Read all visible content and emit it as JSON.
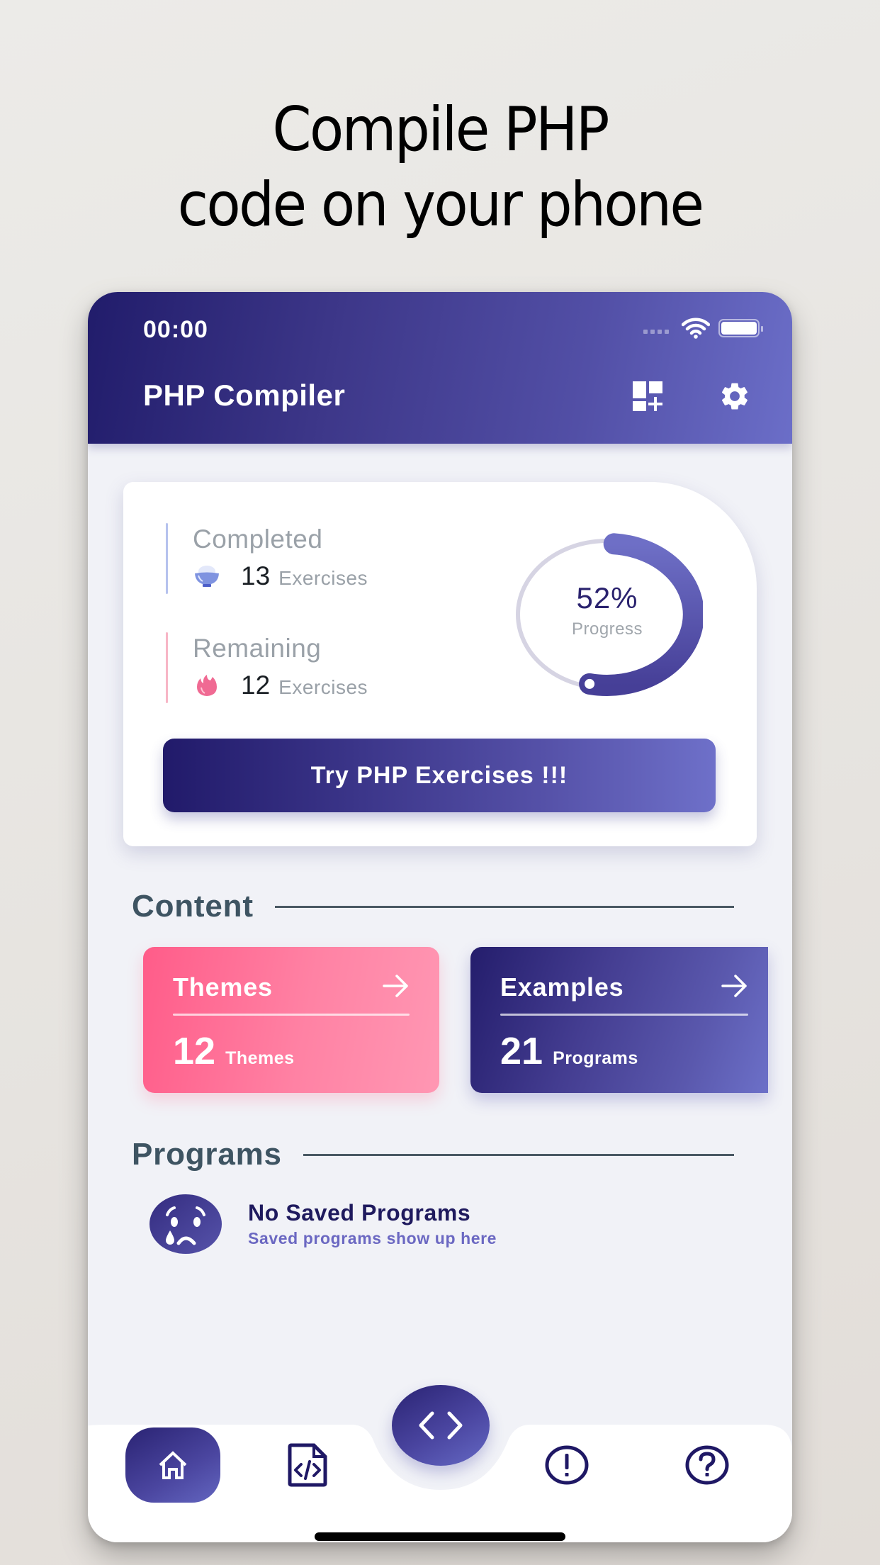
{
  "headline": {
    "line1": "Compile PHP",
    "line2": "code on your phone"
  },
  "status_bar": {
    "time": "00:00",
    "icons": [
      "signal-icon",
      "wifi-icon",
      "battery-icon"
    ]
  },
  "app_bar": {
    "title": "PHP Compiler",
    "actions": [
      {
        "name": "add-widget-icon"
      },
      {
        "name": "gear-icon"
      }
    ]
  },
  "progress_card": {
    "completed": {
      "label": "Completed",
      "count": "13",
      "unit": "Exercises",
      "icon": "rice-bowl-icon",
      "accent": "#b6c2ee"
    },
    "remaining": {
      "label": "Remaining",
      "count": "12",
      "unit": "Exercises",
      "icon": "flame-icon",
      "accent": "#f7b6c6"
    },
    "progress": {
      "value_text": "52%",
      "label": "Progress",
      "fraction": 0.52
    },
    "cta_label": "Try PHP Exercises !!!"
  },
  "content_section": {
    "title": "Content",
    "tiles": [
      {
        "title": "Themes",
        "count": "12",
        "unit": "Themes",
        "color": "#ff6e96"
      },
      {
        "title": "Examples",
        "count": "21",
        "unit": "Programs",
        "color": "#3f3a8e"
      }
    ]
  },
  "programs_section": {
    "title": "Programs",
    "empty_title": "No Saved Programs",
    "empty_subtitle": "Saved programs show up here"
  },
  "bottom_nav": {
    "items": [
      {
        "name": "home-icon",
        "active": true
      },
      {
        "name": "code-file-icon",
        "active": false
      },
      {
        "name": "code-brackets-icon",
        "fab": true
      },
      {
        "name": "alert-icon",
        "active": false
      },
      {
        "name": "help-icon",
        "active": false
      }
    ]
  },
  "colors": {
    "primary_dark": "#211c6b",
    "primary_light": "#6b6ec8",
    "pink": "#ff6e96",
    "background": "#f1f2f7"
  }
}
